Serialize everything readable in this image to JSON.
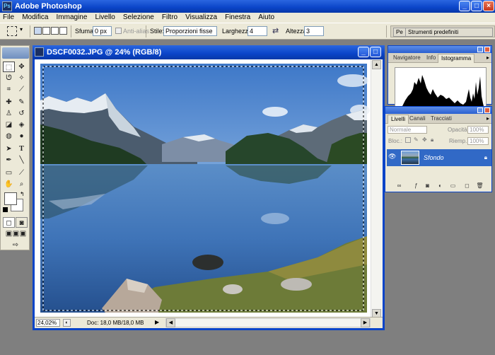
{
  "app": {
    "title": "Adobe Photoshop",
    "icon": "photoshop-icon"
  },
  "menu": [
    "File",
    "Modifica",
    "Immagine",
    "Livello",
    "Selezione",
    "Filtro",
    "Visualizza",
    "Finestra",
    "Aiuto"
  ],
  "options": {
    "sfumatura_label": "Sfuma:",
    "sfumatura_value": "0 px",
    "antialias_label": "Anti-alias",
    "stile_label": "Stile:",
    "stile_value": "Proporzioni fisse",
    "larghezza_label": "Larghezza:",
    "larghezza_value": "4",
    "altezza_label": "Altezza:",
    "altezza_value": "3",
    "palette_tab_1": "Pe",
    "palette_tab_2": "Strumenti predefiniti"
  },
  "document": {
    "title": "DSCF0032.JPG @ 24% (RGB/8)",
    "zoom": "24,02%",
    "doc_info": "Doc: 18,0 MB/18,0 MB"
  },
  "navigator": {
    "tabs": [
      "Navigatore",
      "Info",
      "Istogramma"
    ],
    "active_tab": "Istogramma"
  },
  "layers": {
    "tabs": [
      "Livelli",
      "Canali",
      "Tracciati"
    ],
    "blend_mode": "Normale",
    "opacity_label": "Opacità:",
    "opacity_value": "100%",
    "lock_label": "Bloc.:",
    "fill_label": "Riemp.:",
    "fill_value": "100%",
    "layer_name": "Sfondo"
  },
  "colors": {
    "titlebar": "#0a44c8",
    "chrome": "#ece9d8",
    "workspace": "#7f7f7f",
    "selected_layer": "#3169c6"
  }
}
